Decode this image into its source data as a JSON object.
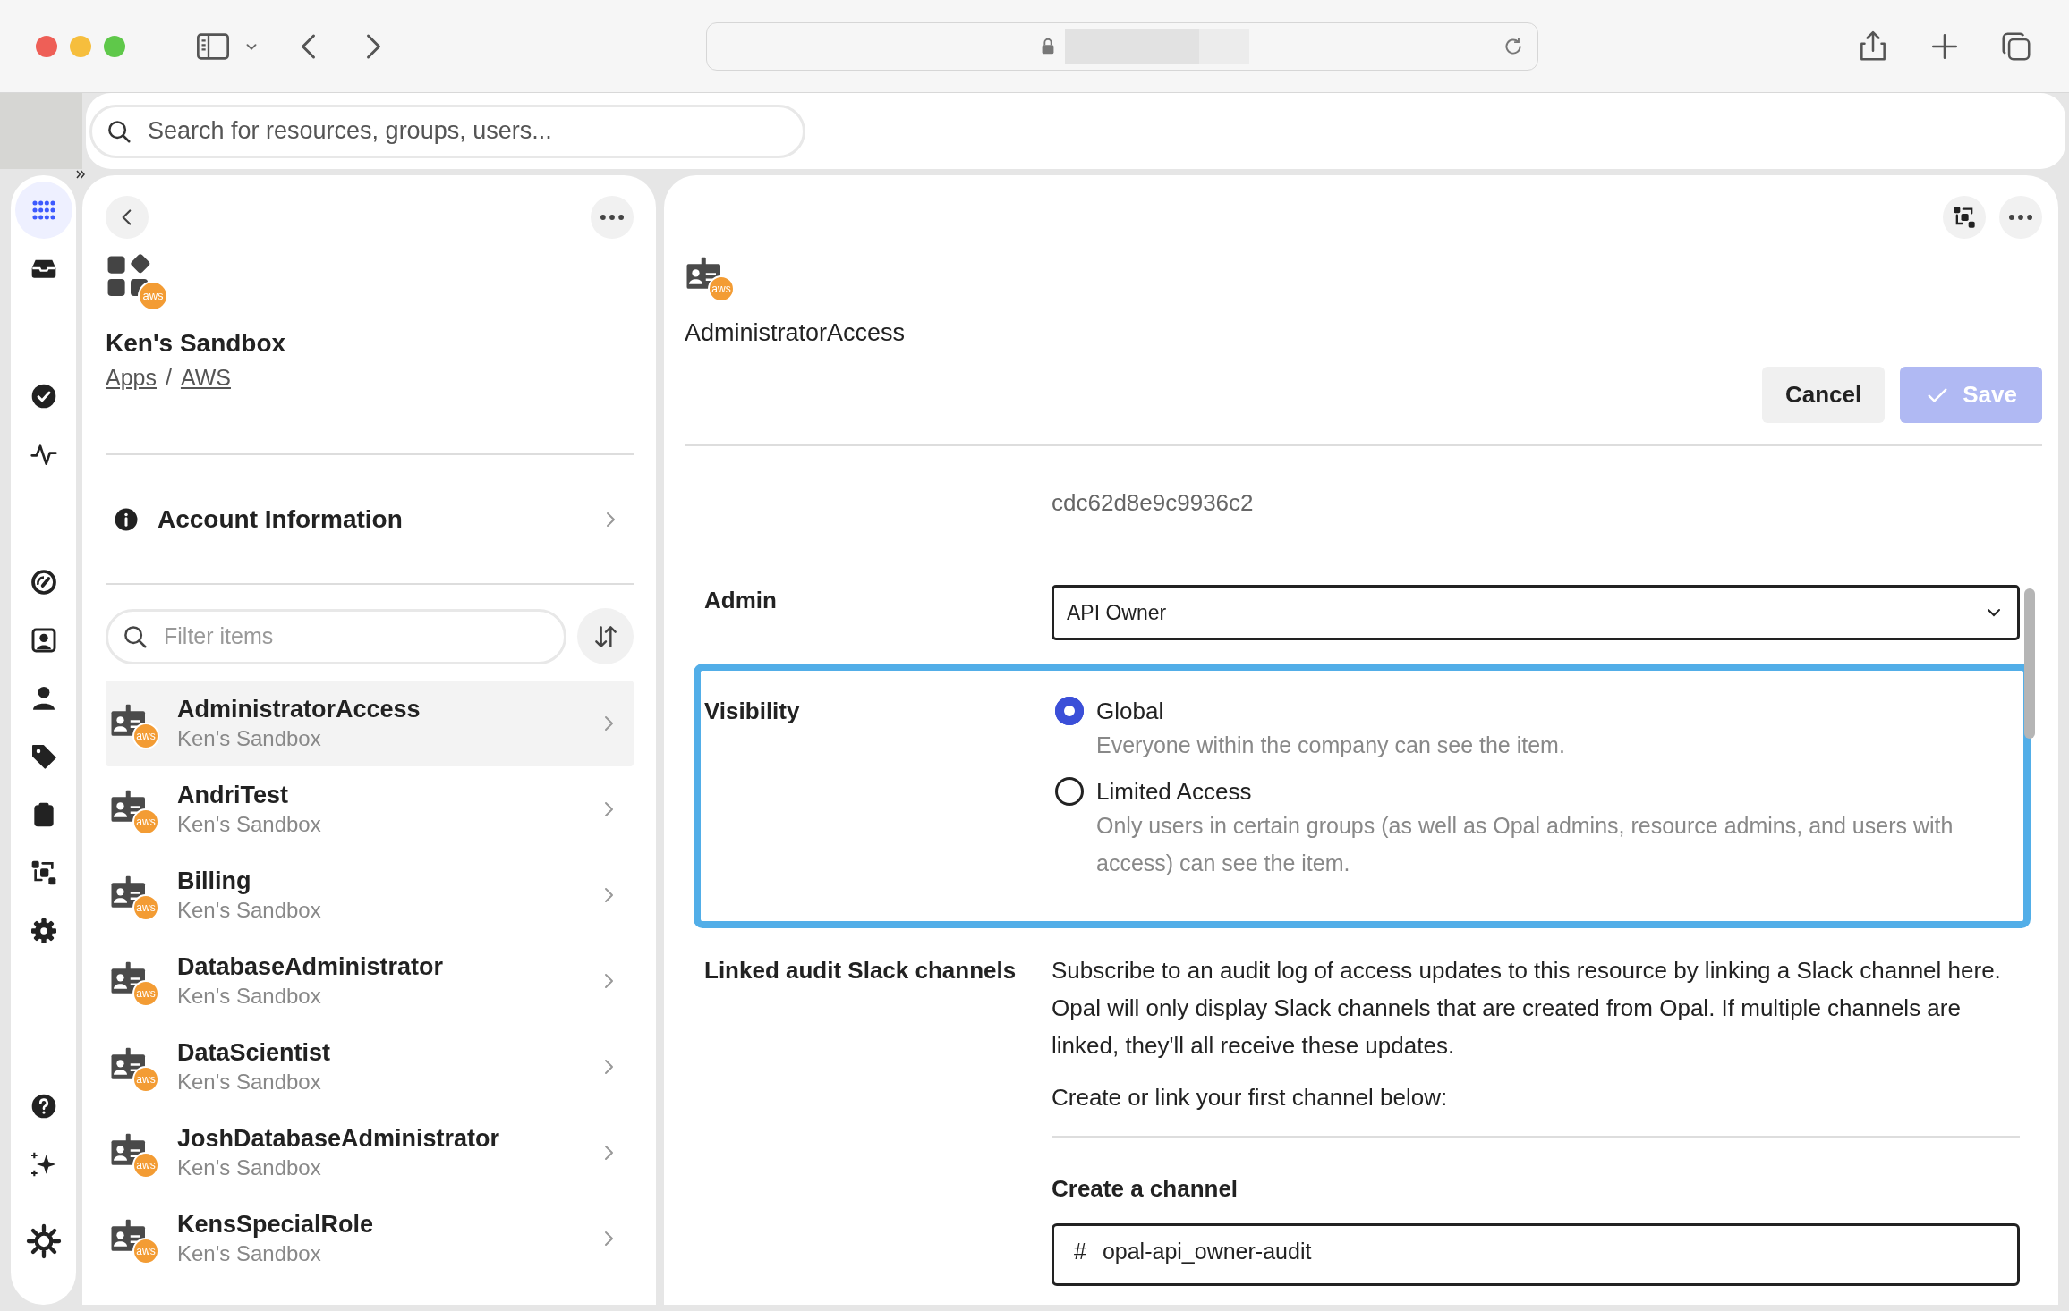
{
  "search": {
    "placeholder": "Search for resources, groups, users..."
  },
  "nav_rail": [
    {
      "kind": "apps",
      "selected": true
    },
    {
      "kind": "inbox",
      "selected": false
    },
    {
      "kind": "check",
      "selected": false
    },
    {
      "kind": "activity",
      "selected": false
    },
    {
      "kind": "gauge",
      "selected": false
    },
    {
      "kind": "contact",
      "selected": false
    },
    {
      "kind": "user",
      "selected": false
    },
    {
      "kind": "tag",
      "selected": false
    },
    {
      "kind": "clipboard",
      "selected": false
    },
    {
      "kind": "flow",
      "selected": false
    },
    {
      "kind": "gear",
      "selected": false
    },
    {
      "kind": "help",
      "selected": false
    },
    {
      "kind": "sparkle",
      "selected": false
    },
    {
      "kind": "theme",
      "selected": false
    }
  ],
  "app": {
    "title": "Ken's Sandbox",
    "badge": "aws",
    "breadcrumbs": [
      "Apps",
      "AWS"
    ],
    "separator": "/"
  },
  "account_section": {
    "label": "Account Information"
  },
  "filter": {
    "placeholder": "Filter items"
  },
  "items": [
    {
      "name": "AdministratorAccess",
      "subtitle": "Ken's Sandbox",
      "badge": "aws",
      "selected": true
    },
    {
      "name": "AndriTest",
      "subtitle": "Ken's Sandbox",
      "badge": "aws",
      "selected": false
    },
    {
      "name": "Billing",
      "subtitle": "Ken's Sandbox",
      "badge": "aws",
      "selected": false
    },
    {
      "name": "DatabaseAdministrator",
      "subtitle": "Ken's Sandbox",
      "badge": "aws",
      "selected": false
    },
    {
      "name": "DataScientist",
      "subtitle": "Ken's Sandbox",
      "badge": "aws",
      "selected": false
    },
    {
      "name": "JoshDatabaseAdministrator",
      "subtitle": "Ken's Sandbox",
      "badge": "aws",
      "selected": false
    },
    {
      "name": "KensSpecialRole",
      "subtitle": "Ken's Sandbox",
      "badge": "aws",
      "selected": false
    }
  ],
  "detail": {
    "title": "AdministratorAccess",
    "badge": "aws",
    "buttons": [
      {
        "kind": "cancel",
        "label": "Cancel",
        "disabled": false
      },
      {
        "kind": "save",
        "label": "Save",
        "disabled": true
      }
    ],
    "rows": [
      {
        "kind": "text",
        "value": "cdc62d8e9c9936c2"
      },
      {
        "kind": "select",
        "label": "Admin",
        "value": "API Owner"
      },
      {
        "kind": "radio",
        "label": "Visibility",
        "highlighted": true,
        "options": [
          {
            "label": "Global",
            "description": "Everyone within the company can see the item.",
            "selected": true
          },
          {
            "label": "Limited Access",
            "description": "Only users in certain groups (as well as Opal admins, resource admins, and users with access) can see the item.",
            "selected": false
          }
        ]
      },
      {
        "kind": "slack",
        "label": "Linked audit Slack channels",
        "paragraphs": [
          "Subscribe to an audit log of access updates to this resource by linking a Slack channel here. Opal will only display Slack channels that are created from Opal. If multiple channels are linked, they'll all receive these updates.",
          "Create or link your first channel below:"
        ],
        "subheading": "Create a channel",
        "prefix": "#",
        "value": "opal-api_owner-audit"
      }
    ]
  }
}
